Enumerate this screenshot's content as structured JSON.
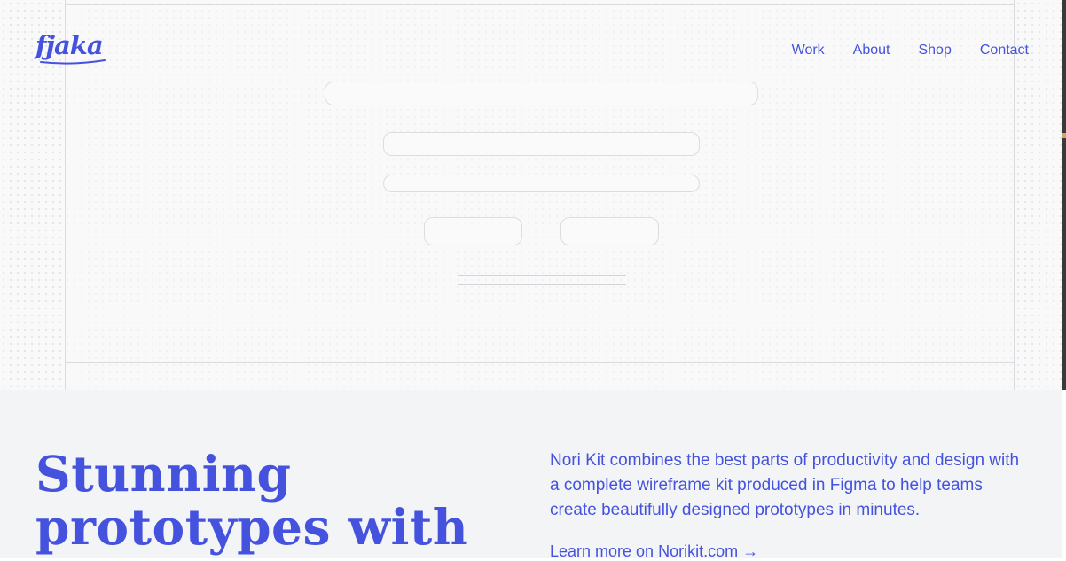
{
  "brand": {
    "logo_text": "fjaka",
    "accent_color": "#4452de"
  },
  "nav": {
    "items": [
      "Work",
      "About",
      "Shop",
      "Contact"
    ]
  },
  "hero": {
    "headline_line1": "Stunning",
    "headline_line2": "prototypes with",
    "description": "Nori Kit combines the best parts of productivity and design with a complete wireframe kit produced in Figma to help teams create beautifully designed prototypes in minutes.",
    "learn_more": "Learn more on Norikit.com →"
  }
}
